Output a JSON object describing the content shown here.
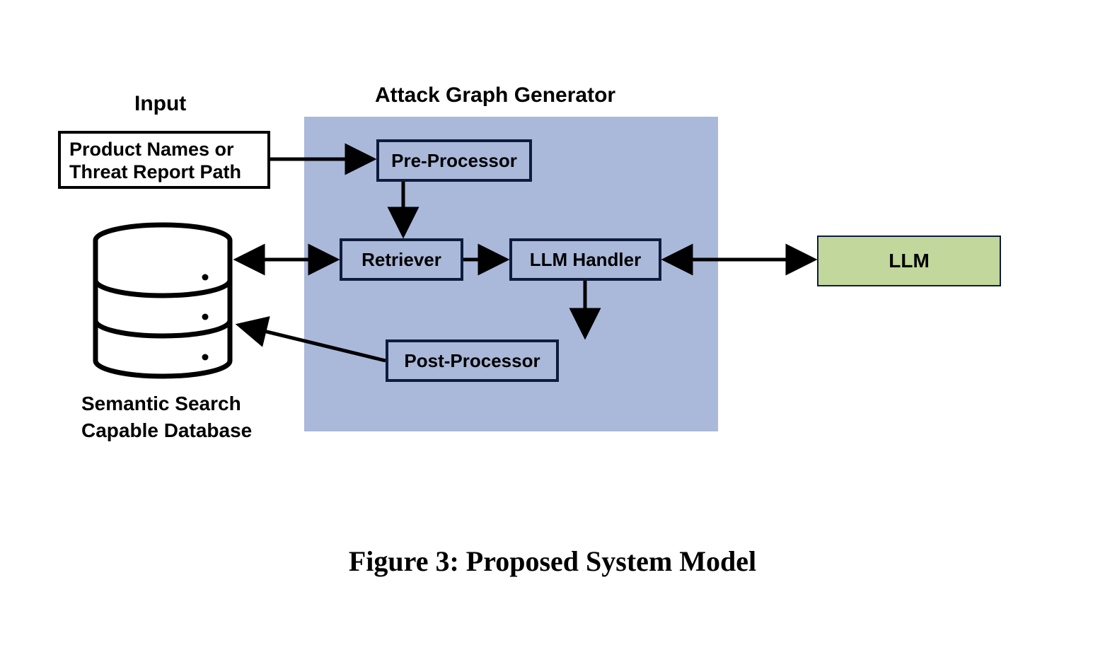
{
  "labels": {
    "input_title": "Input",
    "generator_title": "Attack Graph Generator",
    "db_label_line1": "Semantic Search",
    "db_label_line2": "Capable Database"
  },
  "input_box": {
    "line1": "Product Names or",
    "line2": "Threat Report Path"
  },
  "generator": {
    "pre_processor": "Pre-Processor",
    "retriever": "Retriever",
    "llm_handler": "LLM Handler",
    "post_processor": "Post-Processor"
  },
  "llm": {
    "label": "LLM"
  },
  "caption": "Figure 3: Proposed System Model"
}
